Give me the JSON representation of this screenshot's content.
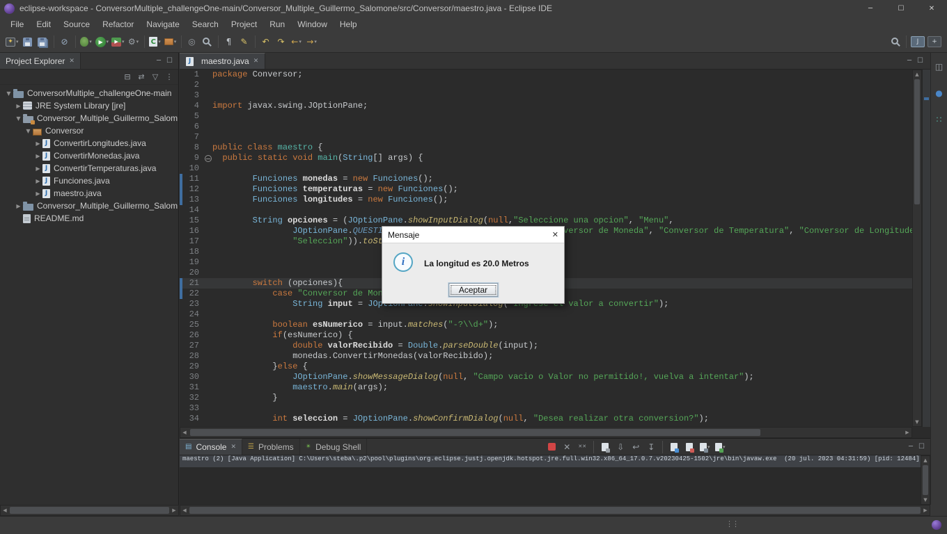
{
  "window": {
    "title": "eclipse-workspace - ConversorMultiple_challengeOne-main/Conversor_Multiple_Guillermo_Salomone/src/Conversor/maestro.java - Eclipse IDE",
    "min_glyph": "─",
    "max_glyph": "☐",
    "close_glyph": "✕"
  },
  "glyphs": {
    "dd": "▾",
    "close": "✕",
    "min": "─",
    "max": "☐",
    "up": "▲",
    "down": "▼",
    "left": "◀",
    "right": "▶",
    "handle": "⋮⋮",
    "twisty_collapsed": "▶",
    "twisty_expanded": "▼"
  },
  "icons": {
    "java_letter": "J"
  },
  "menu": {
    "items": [
      "File",
      "Edit",
      "Source",
      "Refactor",
      "Navigate",
      "Search",
      "Project",
      "Run",
      "Window",
      "Help"
    ]
  },
  "toolbar": {
    "items": [
      {
        "n": "new-wizard",
        "sh": "new",
        "g": "✦",
        "dd": 1
      },
      {
        "n": "save",
        "sh": "floppy"
      },
      {
        "n": "save-all",
        "sh": "floppyall"
      },
      {
        "sep": 1
      },
      {
        "n": "skip-all-breakpoints",
        "g": "⊘",
        "c": "#9db1c7"
      },
      {
        "sep": 1
      },
      {
        "n": "debug",
        "sh": "bug",
        "dd": 1
      },
      {
        "n": "run",
        "sh": "run",
        "g": "▶",
        "dd": 1
      },
      {
        "n": "coverage",
        "sh": "cov",
        "g": "▶",
        "dd": 1
      },
      {
        "n": "run-external-tools",
        "g": "⚙",
        "c": "#9aa0a6",
        "dd": 1
      },
      {
        "sep": 1
      },
      {
        "n": "new-java-class",
        "sh": "classnew",
        "g": "C",
        "dd": 1
      },
      {
        "n": "new-java-package",
        "sh": "pkgnew",
        "dd": 1
      },
      {
        "sep": 1
      },
      {
        "n": "open-type",
        "g": "◎",
        "c": "#9aa0a6"
      },
      {
        "n": "search",
        "sh": "search"
      },
      {
        "sep": 1
      },
      {
        "n": "show-whitespace",
        "g": "¶",
        "c": "#b9bec3"
      },
      {
        "n": "format-annotate",
        "g": "✎",
        "c": "#d9c267"
      },
      {
        "sep": 1
      },
      {
        "n": "last-edit-location",
        "g": "↶",
        "c": "#d9c267"
      },
      {
        "n": "next-edit-location",
        "g": "↷",
        "c": "#d9c267"
      },
      {
        "n": "back",
        "g": "←",
        "c": "#d2a94f",
        "dd": 1
      },
      {
        "n": "forward",
        "g": "→",
        "c": "#d2a94f",
        "dd": 1
      }
    ],
    "right_items": [
      {
        "n": "quick-search",
        "sh": "search"
      },
      {
        "sep": 1
      },
      {
        "n": "java-perspective",
        "sh": "persp",
        "g": "J",
        "active": 1
      },
      {
        "n": "open-perspective",
        "sh": "persp",
        "g": "+"
      }
    ]
  },
  "sidebar": {
    "title": "Project Explorer",
    "toolbar": [
      {
        "n": "collapse-all",
        "g": "⊟",
        "c": "#9aa0a6"
      },
      {
        "n": "link-with-editor",
        "g": "⇄",
        "c": "#9aa0a6"
      },
      {
        "n": "filter",
        "g": "▽",
        "c": "#9aa0a6"
      },
      {
        "n": "view-menu",
        "g": "⋮",
        "c": "#9aa0a6"
      }
    ],
    "tree": [
      {
        "d": 0,
        "tw": "e",
        "icon": "project",
        "label": "ConversorMultiple_challengeOne-main"
      },
      {
        "d": 1,
        "tw": "c",
        "icon": "jre",
        "label": "JRE System Library [jre]"
      },
      {
        "d": 1,
        "tw": "e",
        "icon": "srcfolder",
        "label": "Conversor_Multiple_Guillermo_Salom"
      },
      {
        "d": 2,
        "tw": "e",
        "icon": "pkg",
        "label": "Conversor"
      },
      {
        "d": 3,
        "tw": "c",
        "icon": "java",
        "label": "ConvertirLongitudes.java"
      },
      {
        "d": 3,
        "tw": "c",
        "icon": "java",
        "label": "ConvertirMonedas.java"
      },
      {
        "d": 3,
        "tw": "c",
        "icon": "java",
        "label": "ConvertirTemperaturas.java"
      },
      {
        "d": 3,
        "tw": "c",
        "icon": "java",
        "label": "Funciones.java"
      },
      {
        "d": 3,
        "tw": "c",
        "icon": "java",
        "label": "maestro.java"
      },
      {
        "d": 1,
        "tw": "c",
        "icon": "folder",
        "label": "Conversor_Multiple_Guillermo_Salom"
      },
      {
        "d": 1,
        "tw": "",
        "icon": "file",
        "label": "README.md"
      }
    ]
  },
  "editor": {
    "tab": "maestro.java",
    "changed_lines": [
      11,
      12,
      13,
      21,
      22
    ],
    "lines": [
      {
        "n": 1,
        "i": 0,
        "t": [
          [
            "k",
            "package"
          ],
          [
            "d",
            " Conversor;"
          ]
        ]
      },
      {
        "n": 2,
        "i": 0,
        "t": []
      },
      {
        "n": 3,
        "i": 0,
        "t": []
      },
      {
        "n": 4,
        "i": 0,
        "t": [
          [
            "k",
            "import"
          ],
          [
            "d",
            " javax.swing.JOptionPane;"
          ]
        ]
      },
      {
        "n": 5,
        "i": 0,
        "t": []
      },
      {
        "n": 6,
        "i": 0,
        "t": []
      },
      {
        "n": 7,
        "i": 0,
        "t": []
      },
      {
        "n": 8,
        "i": 0,
        "t": [
          [
            "k",
            "public"
          ],
          [
            "d",
            " "
          ],
          [
            "k",
            "class"
          ],
          [
            "d",
            " "
          ],
          [
            "f",
            "maestro"
          ],
          [
            "d",
            " {"
          ]
        ]
      },
      {
        "n": 9,
        "i": 2,
        "fold": true,
        "t": [
          [
            "k",
            "public"
          ],
          [
            "d",
            " "
          ],
          [
            "k",
            "static"
          ],
          [
            "d",
            " "
          ],
          [
            "k",
            "void"
          ],
          [
            "d",
            " "
          ],
          [
            "f",
            "main"
          ],
          [
            "d",
            "("
          ],
          [
            "c",
            "String"
          ],
          [
            "d",
            "[] args) {"
          ]
        ]
      },
      {
        "n": 10,
        "i": 0,
        "t": []
      },
      {
        "n": 11,
        "i": 8,
        "t": [
          [
            "c",
            "Funciones"
          ],
          [
            "d",
            " "
          ],
          [
            "v",
            "monedas"
          ],
          [
            "d",
            " = "
          ],
          [
            "k",
            "new"
          ],
          [
            "d",
            " "
          ],
          [
            "c",
            "Funciones"
          ],
          [
            "d",
            "();"
          ]
        ]
      },
      {
        "n": 12,
        "i": 8,
        "t": [
          [
            "c",
            "Funciones"
          ],
          [
            "d",
            " "
          ],
          [
            "v",
            "temperaturas"
          ],
          [
            "d",
            " = "
          ],
          [
            "k",
            "new"
          ],
          [
            "d",
            " "
          ],
          [
            "c",
            "Funciones"
          ],
          [
            "d",
            "();"
          ]
        ]
      },
      {
        "n": 13,
        "i": 8,
        "t": [
          [
            "c",
            "Funciones"
          ],
          [
            "d",
            " "
          ],
          [
            "v",
            "longitudes"
          ],
          [
            "d",
            " = "
          ],
          [
            "k",
            "new"
          ],
          [
            "d",
            " "
          ],
          [
            "c",
            "Funciones"
          ],
          [
            "d",
            "();"
          ]
        ]
      },
      {
        "n": 14,
        "i": 0,
        "t": []
      },
      {
        "n": 15,
        "i": 8,
        "t": [
          [
            "c",
            "String"
          ],
          [
            "d",
            " "
          ],
          [
            "v",
            "opciones"
          ],
          [
            "d",
            " = ("
          ],
          [
            "c",
            "JOptionPane"
          ],
          [
            "d",
            "."
          ],
          [
            "m",
            "showInputDialog"
          ],
          [
            "d",
            "("
          ],
          [
            "k",
            "null"
          ],
          [
            "d",
            ","
          ],
          [
            "s",
            "\"Seleccione una opcion\""
          ],
          [
            "d",
            ", "
          ],
          [
            "s",
            "\"Menu\""
          ],
          [
            "d",
            ","
          ]
        ]
      },
      {
        "n": 16,
        "i": 16,
        "t": [
          [
            "c",
            "JOptionPane"
          ],
          [
            "d",
            "."
          ],
          [
            "sf",
            "QUESTION_MESSAGE"
          ],
          [
            "d",
            ", "
          ],
          [
            "k",
            "null"
          ],
          [
            "d",
            ", "
          ],
          [
            "k",
            "new"
          ],
          [
            "d",
            " "
          ],
          [
            "c",
            "Object"
          ],
          [
            "d",
            "[] {"
          ],
          [
            "s",
            "\"Conversor de Moneda\""
          ],
          [
            "d",
            ", "
          ],
          [
            "s",
            "\"Conversor de Temperatura\""
          ],
          [
            "d",
            ", "
          ],
          [
            "s",
            "\"Conversor de Longitudes\""
          ],
          [
            "d",
            ","
          ]
        ]
      },
      {
        "n": 17,
        "i": 16,
        "t": [
          [
            "s",
            "\"Seleccion\""
          ],
          [
            "d",
            "))."
          ],
          [
            "m",
            "toString"
          ],
          [
            "d",
            "();"
          ]
        ]
      },
      {
        "n": 18,
        "i": 0,
        "t": []
      },
      {
        "n": 19,
        "i": 0,
        "t": []
      },
      {
        "n": 20,
        "i": 0,
        "t": []
      },
      {
        "n": 21,
        "i": 8,
        "cur": true,
        "t": [
          [
            "k",
            "switch"
          ],
          [
            "d",
            " (opciones){"
          ]
        ]
      },
      {
        "n": 22,
        "i": 12,
        "t": [
          [
            "k",
            "case"
          ],
          [
            "d",
            " "
          ],
          [
            "s",
            "\"Conversor de Moneda\""
          ],
          [
            "d",
            ":"
          ]
        ]
      },
      {
        "n": 23,
        "i": 16,
        "t": [
          [
            "c",
            "String"
          ],
          [
            "d",
            " "
          ],
          [
            "v",
            "input"
          ],
          [
            "d",
            " = "
          ],
          [
            "c",
            "JOptionPane"
          ],
          [
            "d",
            "."
          ],
          [
            "m",
            "showInputDialog"
          ],
          [
            "d",
            "("
          ],
          [
            "s",
            "\"Ingrese el valor a convertir\""
          ],
          [
            "d",
            ");"
          ]
        ]
      },
      {
        "n": 24,
        "i": 0,
        "t": []
      },
      {
        "n": 25,
        "i": 12,
        "t": [
          [
            "k",
            "boolean"
          ],
          [
            "d",
            " "
          ],
          [
            "v",
            "esNumerico"
          ],
          [
            "d",
            " = input."
          ],
          [
            "m",
            "matches"
          ],
          [
            "d",
            "("
          ],
          [
            "s",
            "\"-?\\\\d+\""
          ],
          [
            "d",
            ");"
          ]
        ]
      },
      {
        "n": 26,
        "i": 12,
        "t": [
          [
            "k",
            "if"
          ],
          [
            "d",
            "(esNumerico) {"
          ]
        ]
      },
      {
        "n": 27,
        "i": 16,
        "t": [
          [
            "k",
            "double"
          ],
          [
            "d",
            " "
          ],
          [
            "v",
            "valorRecibido"
          ],
          [
            "d",
            " = "
          ],
          [
            "c",
            "Double"
          ],
          [
            "d",
            "."
          ],
          [
            "m",
            "parseDouble"
          ],
          [
            "d",
            "(input);"
          ]
        ]
      },
      {
        "n": 28,
        "i": 16,
        "t": [
          [
            "d",
            "monedas.ConvertirMonedas(valorRecibido);"
          ]
        ]
      },
      {
        "n": 29,
        "i": 12,
        "t": [
          [
            "d",
            "}"
          ],
          [
            "k",
            "else"
          ],
          [
            "d",
            " {"
          ]
        ]
      },
      {
        "n": 30,
        "i": 16,
        "t": [
          [
            "c",
            "JOptionPane"
          ],
          [
            "d",
            "."
          ],
          [
            "m",
            "showMessageDialog"
          ],
          [
            "d",
            "("
          ],
          [
            "k",
            "null"
          ],
          [
            "d",
            ", "
          ],
          [
            "s",
            "\"Campo vacio o Valor no permitido!, vuelva a intentar\""
          ],
          [
            "d",
            ");"
          ]
        ]
      },
      {
        "n": 31,
        "i": 16,
        "t": [
          [
            "c",
            "maestro"
          ],
          [
            "d",
            "."
          ],
          [
            "m",
            "main"
          ],
          [
            "d",
            "(args);"
          ]
        ]
      },
      {
        "n": 32,
        "i": 12,
        "t": [
          [
            "d",
            "}"
          ]
        ]
      },
      {
        "n": 33,
        "i": 0,
        "t": []
      },
      {
        "n": 34,
        "i": 12,
        "t": [
          [
            "k",
            "int"
          ],
          [
            "d",
            " "
          ],
          [
            "v",
            "seleccion"
          ],
          [
            "d",
            " = "
          ],
          [
            "c",
            "JOptionPane"
          ],
          [
            "d",
            "."
          ],
          [
            "m",
            "showConfirmDialog"
          ],
          [
            "d",
            "("
          ],
          [
            "k",
            "null"
          ],
          [
            "d",
            ", "
          ],
          [
            "s",
            "\"Desea realizar otra conversion?\""
          ],
          [
            "d",
            ");"
          ]
        ]
      }
    ]
  },
  "dialog": {
    "title": "Mensaje",
    "message": "La longitud es 20.0 Metros",
    "button": "Aceptar",
    "close_glyph": "✕",
    "info_glyph": "i"
  },
  "console": {
    "tabs": [
      {
        "label": "Console",
        "icon": "▤",
        "icon_color": "#7fb3d5",
        "active": true,
        "closable": true
      },
      {
        "label": "Problems",
        "icon": "☰",
        "icon_color": "#c8a94a",
        "active": false,
        "closable": false
      },
      {
        "label": "Debug Shell",
        "icon": "✴",
        "icon_color": "#6ba54a",
        "active": false,
        "closable": false
      }
    ],
    "toolbar": [
      {
        "n": "terminate",
        "sh": "stopred"
      },
      {
        "n": "remove-launch",
        "g": "✕",
        "c": "#9aa0a6"
      },
      {
        "n": "remove-all-terminated",
        "g": "✕✕",
        "c": "#9aa0a6",
        "fs": 7
      },
      {
        "sep": 1
      },
      {
        "n": "clear-console",
        "sh": "doc",
        "b": "#9aa0a6"
      },
      {
        "n": "scroll-lock",
        "g": "⇩",
        "c": "#9aa0a6"
      },
      {
        "n": "word-wrap",
        "g": "↩",
        "c": "#9aa0a6"
      },
      {
        "n": "pin-console",
        "g": "↧",
        "c": "#9aa0a6"
      },
      {
        "sep": 1
      },
      {
        "n": "show-stdout",
        "sh": "doc",
        "b": "#4a8fd4"
      },
      {
        "n": "show-stderr",
        "sh": "doc",
        "b": "#cf5b56"
      },
      {
        "n": "display-selected-console",
        "sh": "doc",
        "b": "#7d8a96",
        "dd": 1
      },
      {
        "n": "open-console",
        "sh": "doc",
        "b": "#54a254",
        "dd": 1
      }
    ],
    "text": "maestro (2) [Java Application] C:\\Users\\steba\\.p2\\pool\\plugins\\org.eclipse.justj.openjdk.hotspot.jre.full.win32.x86_64_17.0.7.v20230425-1502\\jre\\bin\\javaw.exe  (20 jul. 2023 04:31:59) [pid: 12484]"
  },
  "right_trim": {
    "items": [
      {
        "n": "restore-minimized-view",
        "g": "◫",
        "c": "#9aa0a6"
      },
      {
        "n": "minimized-welcome-view",
        "g": "●",
        "c": "#4a86c8"
      },
      {
        "n": "minimized-snippets-view",
        "g": "∷",
        "c": "#58b0a0"
      }
    ]
  }
}
